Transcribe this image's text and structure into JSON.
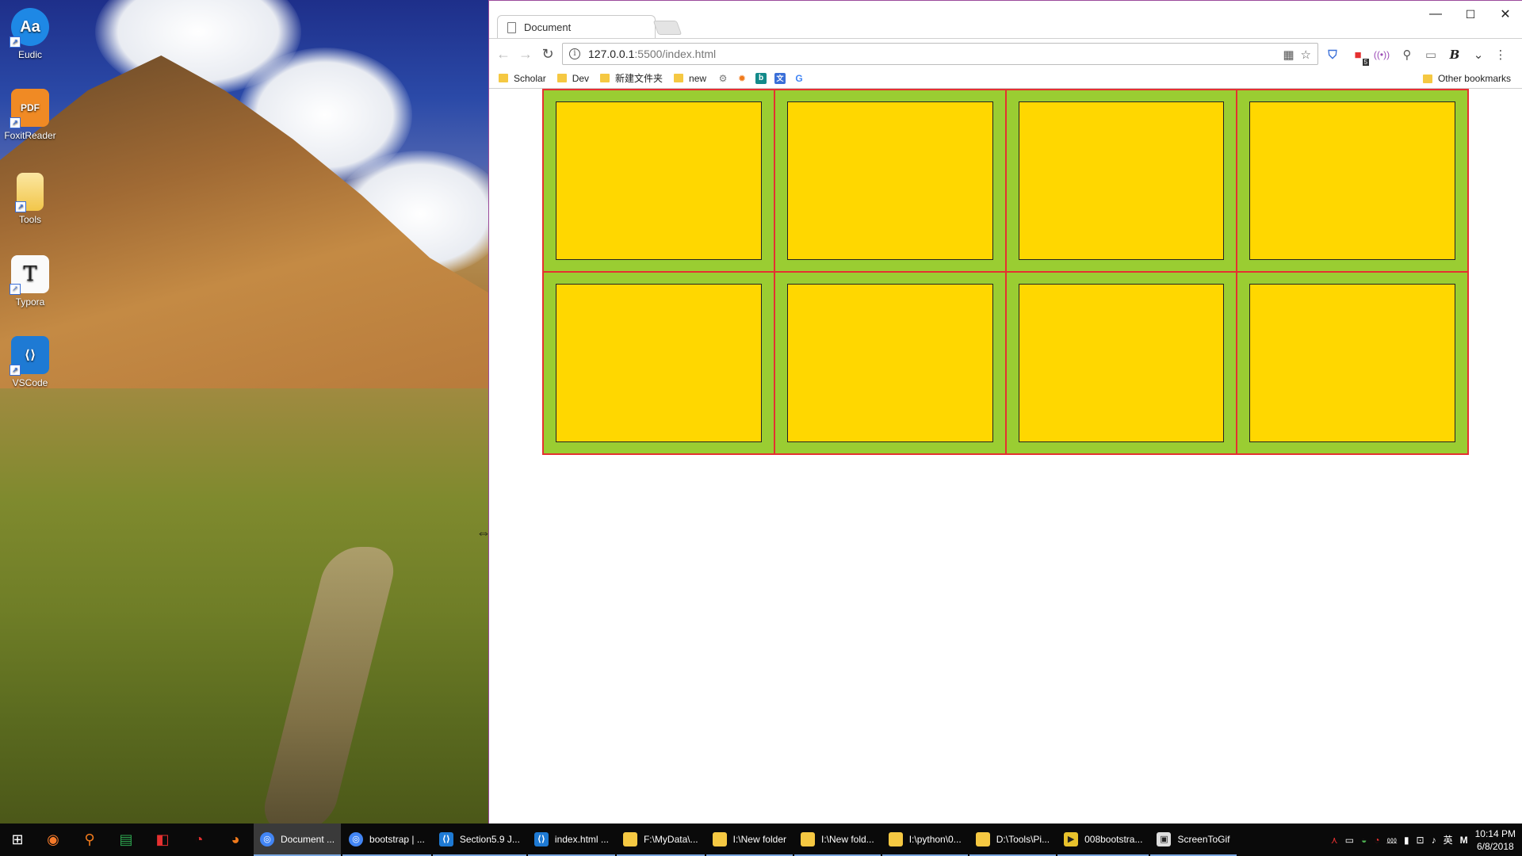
{
  "desktop": {
    "icons": [
      {
        "label": "Eudic",
        "icon": "eudic-icon",
        "color": "#1e88e5",
        "glyph": "Aa"
      },
      {
        "label": "FoxitReader",
        "icon": "foxit-pdf-icon",
        "color": "#f08a24",
        "glyph": "PDF"
      },
      {
        "label": "Tools",
        "icon": "folder-icon",
        "color": "#f5c842",
        "glyph": ""
      },
      {
        "label": "Typora",
        "icon": "typora-icon",
        "color": "#ffffff",
        "glyph": "T"
      },
      {
        "label": "VSCode",
        "icon": "vscode-icon",
        "color": "#1e7ad4",
        "glyph": "⟨⟩"
      }
    ]
  },
  "browser": {
    "tab_title": "Document",
    "url_host": "127.0.0.1",
    "url_rest": ":5500/index.html",
    "bookmarks": [
      {
        "label": "Scholar",
        "type": "folder"
      },
      {
        "label": "Dev",
        "type": "folder"
      },
      {
        "label": "新建文件夹",
        "type": "folder"
      },
      {
        "label": "new",
        "type": "folder"
      }
    ],
    "bookmark_other": "Other bookmarks",
    "extension_badge": "5"
  },
  "page": {
    "grid_rows": 2,
    "grid_cols": 4,
    "colors": {
      "cell_bg": "#9acd32",
      "box_bg": "#ffd700",
      "border": "#e53030"
    }
  },
  "taskbar": {
    "items": [
      {
        "label": "Document ...",
        "icon": "chrome-icon",
        "color": "#4285f4",
        "active": true
      },
      {
        "label": "bootstrap | ...",
        "icon": "chrome-icon",
        "color": "#4285f4",
        "active": false
      },
      {
        "label": "Section5.9 J...",
        "icon": "vscode-icon",
        "color": "#1e7ad4",
        "active": false
      },
      {
        "label": "index.html ...",
        "icon": "vscode-icon",
        "color": "#1e7ad4",
        "active": false
      },
      {
        "label": "F:\\MyData\\...",
        "icon": "folder-icon",
        "color": "#f5c842",
        "active": false
      },
      {
        "label": "I:\\New folder",
        "icon": "folder-icon",
        "color": "#f5c842",
        "active": false
      },
      {
        "label": "I:\\New fold...",
        "icon": "folder-icon",
        "color": "#f5c842",
        "active": false
      },
      {
        "label": "I:\\python\\0...",
        "icon": "folder-icon",
        "color": "#f5c842",
        "active": false
      },
      {
        "label": "D:\\Tools\\Pi...",
        "icon": "folder-icon",
        "color": "#f5c842",
        "active": false
      },
      {
        "label": "008bootstra...",
        "icon": "player-icon",
        "color": "#e8c22c",
        "active": false
      },
      {
        "label": "ScreenToGif",
        "icon": "screentogif-icon",
        "color": "#dddddd",
        "active": false
      }
    ],
    "ime_label": "英",
    "ime_mode": "M",
    "time": "10:14 PM",
    "date": "6/8/2018"
  }
}
